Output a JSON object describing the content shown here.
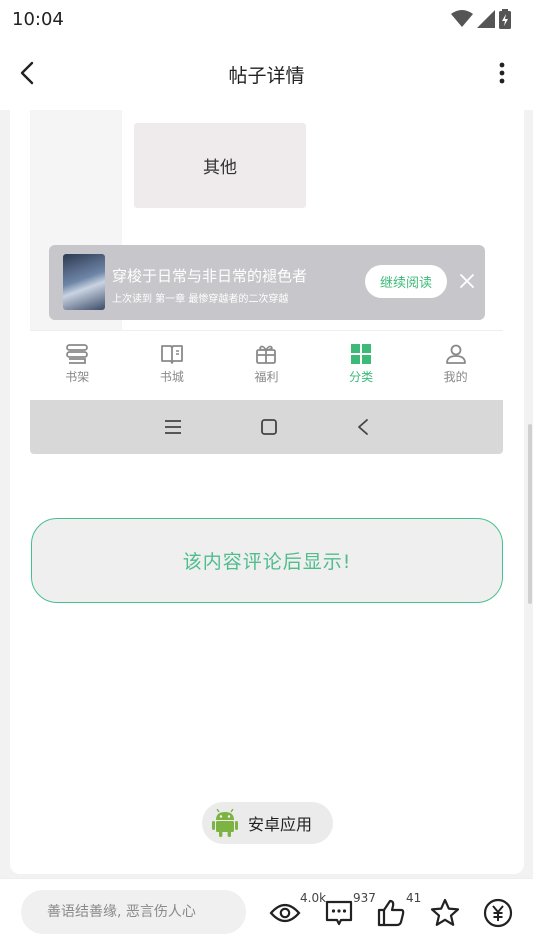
{
  "status": {
    "time": "10:04"
  },
  "header": {
    "title": "帖子详情"
  },
  "screenshot": {
    "category_tile": "其他",
    "banner": {
      "title": "穿梭于日常与非日常的褪色者",
      "subtitle": "上次读到 第一章 最惨穿越者的二次穿越",
      "continue_label": "继续阅读"
    },
    "nav": [
      {
        "label": "书架",
        "icon": "bookshelf-icon",
        "active": false
      },
      {
        "label": "书城",
        "icon": "open-book-icon",
        "active": false
      },
      {
        "label": "福利",
        "icon": "gift-icon",
        "active": false
      },
      {
        "label": "分类",
        "icon": "grid-icon",
        "active": true
      },
      {
        "label": "我的",
        "icon": "person-icon",
        "active": false
      }
    ]
  },
  "hidden_notice": "该内容评论后显示!",
  "app_pill": {
    "label": "安卓应用",
    "icon": "android-icon"
  },
  "bottom_bar": {
    "placeholder": "善语结善缘, 恶言伤人心",
    "views": "4.0k",
    "comments": "937",
    "likes": "41"
  },
  "colors": {
    "accent": "#3dba78",
    "banner": "#c7c6ca"
  }
}
